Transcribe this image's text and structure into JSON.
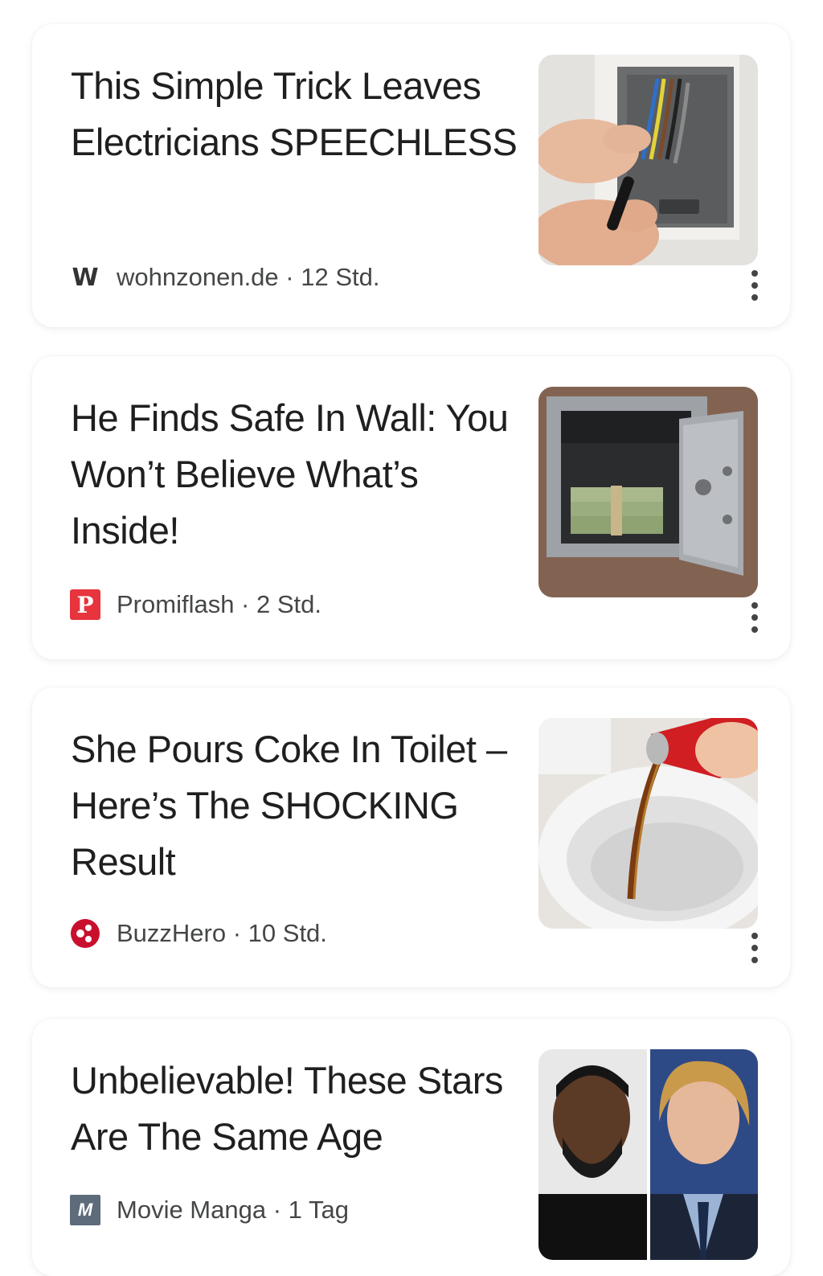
{
  "feed": {
    "cards": [
      {
        "title": "This Simple Trick Leaves Electricians SPEECHLESS",
        "logo_letter": "W",
        "publisher": "wohnzonen.de",
        "age": "12 Std.",
        "image": "hands-connecting-wires-in-wall-box"
      },
      {
        "title": "He Finds Safe In Wall: You Won’t Believe What’s Inside!",
        "logo_letter": "P",
        "logo_color": "#e8343d",
        "publisher": "Promiflash",
        "age": "2 Std.",
        "image": "open-wall-safe-with-cash"
      },
      {
        "title": "She Pours Coke In Toilet – Here’s The SHOCKING Result",
        "logo_color": "#c8102e",
        "publisher": "BuzzHero",
        "age": "10 Std.",
        "image": "pouring-cola-into-toilet"
      },
      {
        "title": "Unbelievable! These Stars Are The Same Age",
        "logo_letter": "M",
        "publisher": "Movie Manga",
        "age": "1 Tag",
        "image": "two-celebrity-portraits"
      }
    ],
    "separator": " · "
  }
}
